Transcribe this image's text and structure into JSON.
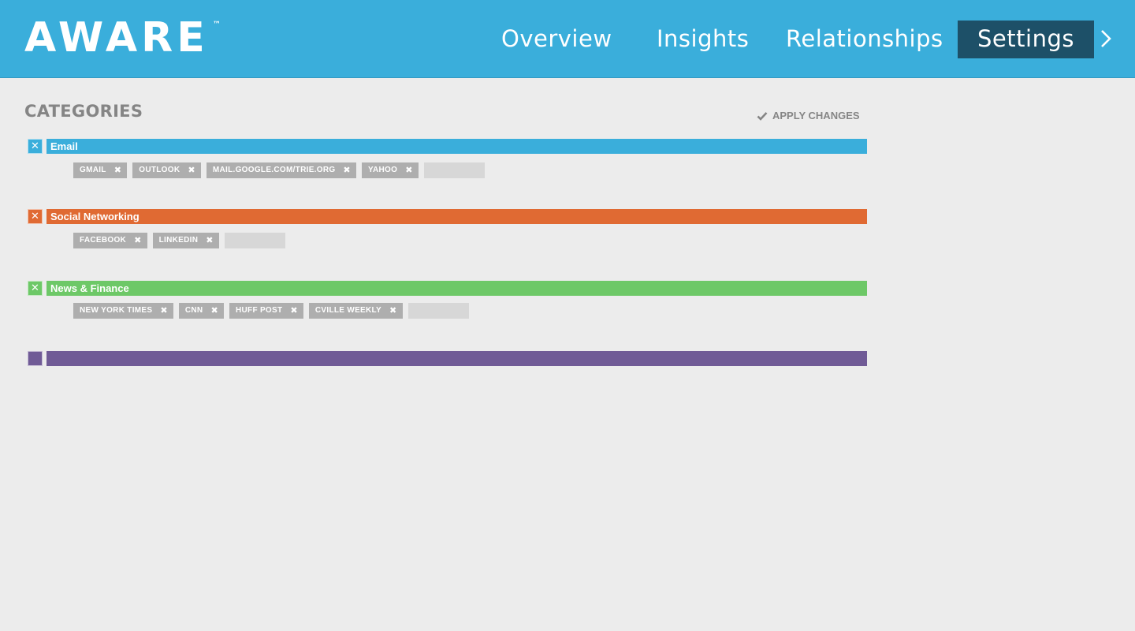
{
  "brand": {
    "logo": "AWARE",
    "tm": "™"
  },
  "nav": {
    "overview": "Overview",
    "insights": "Insights",
    "relationships": "Relationships",
    "settings": "Settings",
    "arrow_icon": "chevron-right-icon"
  },
  "page": {
    "title": "CATEGORIES",
    "apply_label": "APPLY CHANGES",
    "apply_icon": "checkmark-icon"
  },
  "categories": [
    {
      "name": "Email",
      "color": "#3aaedb",
      "toggle": "✕",
      "tags": [
        "GMAIL",
        "OUTLOOK",
        "MAIL.GOOGLE.COM/TRIE.ORG",
        "YAHOO"
      ]
    },
    {
      "name": "Social Networking",
      "color": "#e06a33",
      "toggle": "✕",
      "tags": [
        "FACEBOOK",
        "LINKEDIN"
      ]
    },
    {
      "name": "News & Finance",
      "color": "#6dc867",
      "toggle": "✕",
      "tags": [
        "NEW YORK TIMES",
        "CNN",
        "HUFF POST",
        "CVILLE WEEKLY"
      ]
    },
    {
      "name": "",
      "color": "#705b96",
      "toggle": "",
      "tags": []
    }
  ],
  "tag_remove_glyph": "✖"
}
